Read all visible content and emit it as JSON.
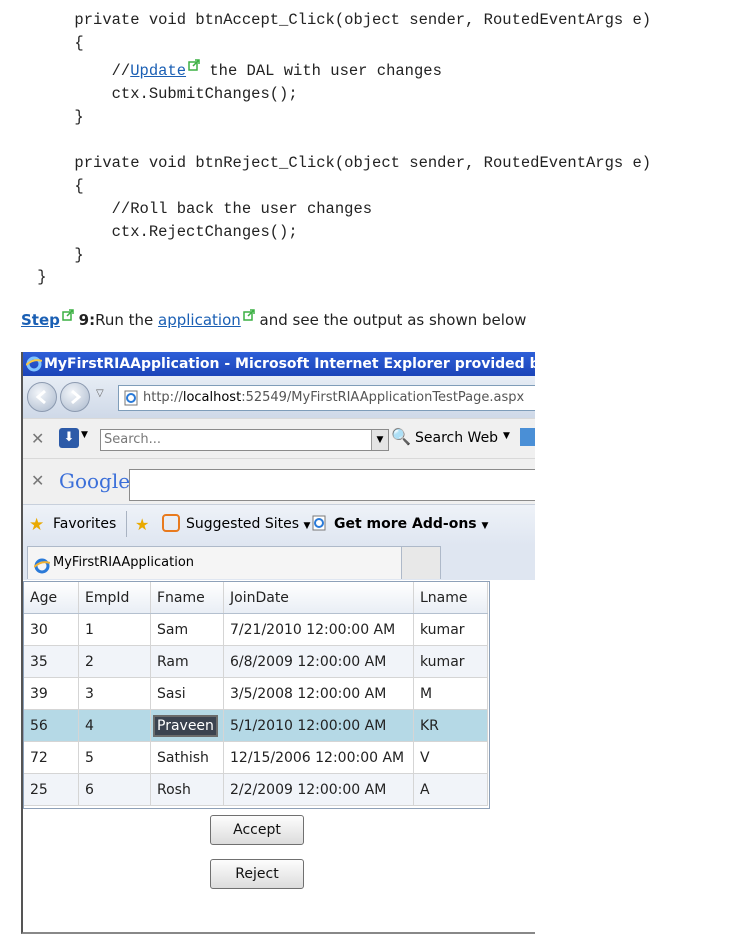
{
  "code": {
    "lines": [
      "        private void btnAccept_Click(object sender, RoutedEventArgs e)",
      "        {",
      "        }",
      "",
      "        private void btnReject_Click(object sender, RoutedEventArgs e)",
      "        {",
      "            //Roll back the user changes",
      "            ctx.RejectChanges();",
      "        }",
      "    }"
    ],
    "comment_prefix": "            //",
    "comment_link": "Update",
    "comment_rest": " the DAL with user changes",
    "submit_line": "            ctx.SubmitChanges();"
  },
  "step": {
    "label": "Step",
    "number": "9:",
    "text_before": "Run the ",
    "link": "application",
    "text_after": " and see the output as shown below"
  },
  "browser": {
    "window_title": "MyFirstRIAApplication - Microsoft Internet Explorer provided by Orion",
    "url_prefix": "http://",
    "url_host": "localhost",
    "url_rest": ":52549/MyFirstRIAApplicationTestPage.aspx",
    "search_placeholder": "Search...",
    "search_web_label": "Search Web",
    "google_label": "Google",
    "favorites_label": "Favorites",
    "suggested_sites_label": "Suggested Sites",
    "addons_label": "Get more Add-ons",
    "tab_title": "MyFirstRIAApplication",
    "colors": {
      "title_bar": "#1b44b8",
      "selected_row": "#b5d9e6"
    }
  },
  "grid": {
    "columns": [
      "Age",
      "EmpId",
      "Fname",
      "JoinDate",
      "Lname"
    ],
    "rows": [
      [
        "30",
        "1",
        "Sam",
        "7/21/2010 12:00:00 AM",
        "kumar"
      ],
      [
        "35",
        "2",
        "Ram",
        "6/8/2009 12:00:00 AM",
        "kumar"
      ],
      [
        "39",
        "3",
        "Sasi",
        "3/5/2008 12:00:00 AM",
        "M"
      ],
      [
        "56",
        "4",
        "Praveen",
        "5/1/2010 12:00:00 AM",
        "KR"
      ],
      [
        "72",
        "5",
        "Sathish",
        "12/15/2006 12:00:00 AM",
        "V"
      ],
      [
        "25",
        "6",
        "Rosh",
        "2/2/2009 12:00:00 AM",
        "A"
      ]
    ],
    "selected_row": 3
  },
  "buttons": {
    "accept": "Accept",
    "reject": "Reject"
  }
}
